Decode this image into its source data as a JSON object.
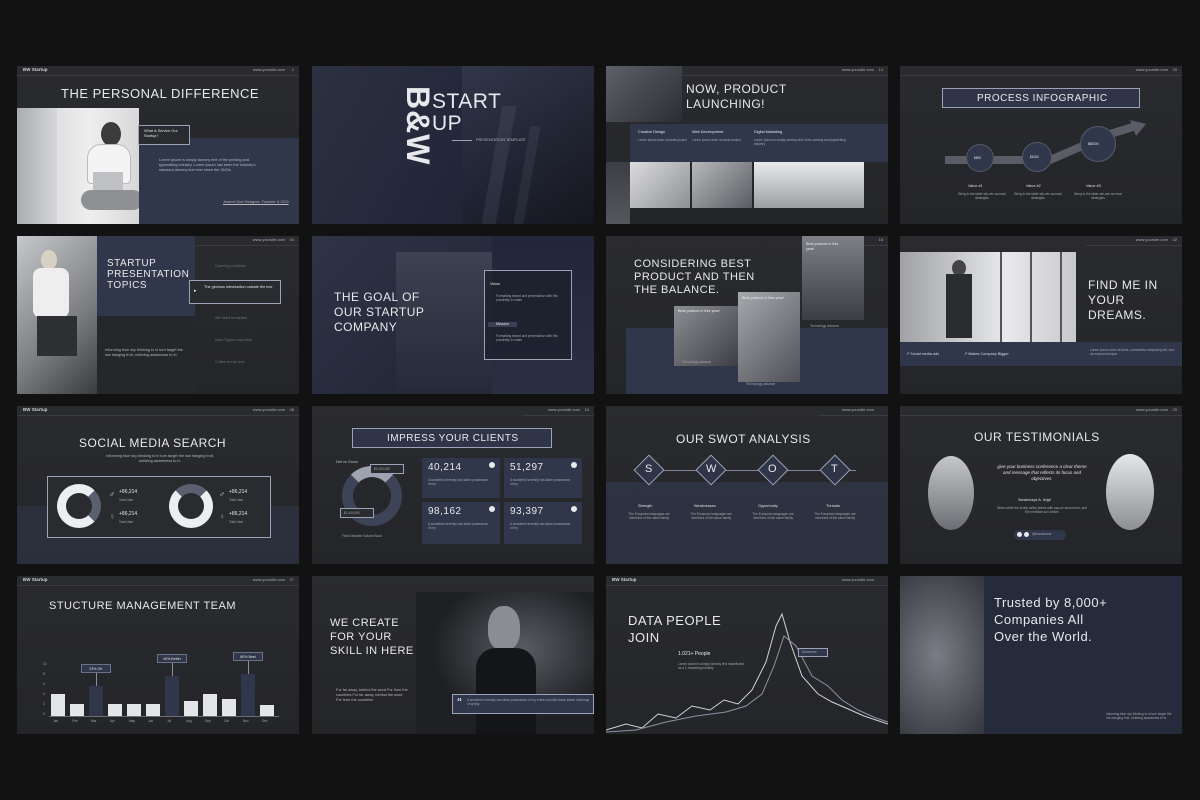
{
  "brand": "BW Startup",
  "url": "www.yoursite.com",
  "s1": {
    "num": "1",
    "title": "THE PERSONAL DIFFERENCE",
    "bubble": "What is Service Our Startup?",
    "body": "Lorem Ipsum is simply dummy text of the printing and typesetting industry. Lorem Ipsum has been the industry's standard dummy text ever since the 1500s.",
    "foot": "Jeanne Doe Designer, Founder & CEO"
  },
  "s2": {
    "logo_left": "B&W",
    "title_line1": "START",
    "title_line2": "UP",
    "subtitle": "PRESENTATION TEMPLATE"
  },
  "s3": {
    "num": "14",
    "title": "NOW, PRODUCT LAUNCHING!",
    "cols": [
      {
        "h": "Creative Design",
        "b": "Lorem ipsum dolor sit amet project"
      },
      {
        "h": "Web Development",
        "b": "Lorem ipsum dolor sit amet project"
      },
      {
        "h": "Digital Marketing",
        "b": "Lorem Ipsum is simply dummy text of the printing and typesetting industry"
      }
    ]
  },
  "s4": {
    "num": "20",
    "title": "PROCESS INFOGRAPHIC",
    "steps": [
      {
        "amount": "$500",
        "label": "Value #1",
        "body": "Bring to the table win-win survival strategies"
      },
      {
        "amount": "$1000",
        "label": "Value #2",
        "body": "Bring to the table win-win survival strategies"
      },
      {
        "amount": "$8000",
        "label": "Value #3",
        "body": "Bring to the table win-win survival strategies"
      }
    ]
  },
  "s5": {
    "num": "04",
    "title": "STARTUP PRESENTATION TOPICS",
    "body": "Informing blue sky thinking to in turn target the low hanging fruit, civilizing awareness to in.",
    "topics": [
      "Opening problems",
      "The glorious introduction outside the box",
      "We need breakfast",
      "Main Topics Important",
      "Coffee break time"
    ]
  },
  "s6": {
    "title": "THE GOAL OF OUR STARTUP COMPANY",
    "vision": "Vision",
    "vision_body": "Formatting tested and presentation with this possibility to make",
    "mission": "Mission",
    "mission_body": "Formatting tested and presentation with this possibility to make"
  },
  "s7": {
    "num": "18",
    "title": "CONSIDERING BEST PRODUCT AND THEN THE BALANCE.",
    "c1": "Best product in this year!",
    "c2": "Best product in this year!",
    "c3": "Best product in this year!",
    "l1": "Technology advance",
    "l2": "Technology advance",
    "l3": "Technology advance"
  },
  "s8": {
    "num": "22",
    "title": "FIND ME IN YOUR DREAMS.",
    "f1": "Social media ads",
    "f2": "Makes Company Bigger",
    "quote": "Lorem ipsum dolor sit amet, consectetur adipiscing elit, sed do eiusmod tempor."
  },
  "s9": {
    "num": "08",
    "title": "SOCIAL MEDIA SEARCH",
    "body": "Informing blue sky thinking to in turn target the low hanging fruit, civilizing awareness to in.",
    "stats": [
      {
        "v": "+86,214",
        "l": "Total User"
      },
      {
        "v": "+86,214",
        "l": "Total User"
      },
      {
        "v": "+86,214",
        "l": "Total User"
      },
      {
        "v": "+86,214",
        "l": "Total User"
      }
    ]
  },
  "s10": {
    "num": "10",
    "title": "IMPRESS YOUR CLIENTS",
    "net": "Net vs Gross",
    "amt1": "$2,400,000",
    "amt2": "$1,400,000",
    "legend": "Fixed  Variable  Volume  Book",
    "cards": [
      {
        "v": "40,214",
        "b": "A wonderful serenity has taken possession of my"
      },
      {
        "v": "51,297",
        "b": "A wonderful serenity has taken possession of my"
      },
      {
        "v": "98,162",
        "b": "A wonderful serenity has taken possession of my"
      },
      {
        "v": "93,397",
        "b": "A wonderful serenity has taken possession of my"
      }
    ]
  },
  "s11": {
    "title": "OUR SWOT ANALYSIS",
    "letters": [
      "S",
      "W",
      "O",
      "T"
    ],
    "labels": [
      "Strength",
      "Weaknesses",
      "Opportunity",
      "Threads"
    ],
    "body": "The European languages are members of the same family"
  },
  "s12": {
    "num": "25",
    "title": "OUR TESTIMONIALS",
    "quote": "give your business conference a clear theme and message that reflects its focus and objectives.",
    "name": "Sarahmaya A. leigh",
    "body": "When while the lovely valley teems with vapour around me, and the meridian sun strikes",
    "handle": "@brandname"
  },
  "s13": {
    "num": "27",
    "title": "STUCTURE MANAGEMENT TEAM",
    "callouts": [
      "23% OK",
      "40% Better",
      "80% Best"
    ],
    "months": [
      "Jan",
      "Feb",
      "Mar",
      "Apr",
      "May",
      "Jun",
      "Jul",
      "Aug",
      "Sep",
      "Oct",
      "Nov",
      "Dec"
    ],
    "yticks": [
      "10",
      "8",
      "6",
      "4",
      "2",
      "0"
    ]
  },
  "s14": {
    "title": "WE CREATE FOR YOUR SKILL IN HERE",
    "body": "For far away, behind the word For from the countries For far away, behind the word For from the countries",
    "quote": "A wonderful serenity has taken possession of my entire soul like these sweet mornings of spring"
  },
  "s15": {
    "num": "",
    "title": "DATA PEOPLE JOIN",
    "count": "1.021+ People",
    "body": "Lorem Ipsum is simply dummy text established as a 1 marketing industry",
    "tag": "December"
  },
  "s16": {
    "title": "Trusted by 8,000+ Companies All Over the World.",
    "body": "Informing blue sky thinking to in turn target the low hanging fruit, civilizing awareness to in."
  }
}
